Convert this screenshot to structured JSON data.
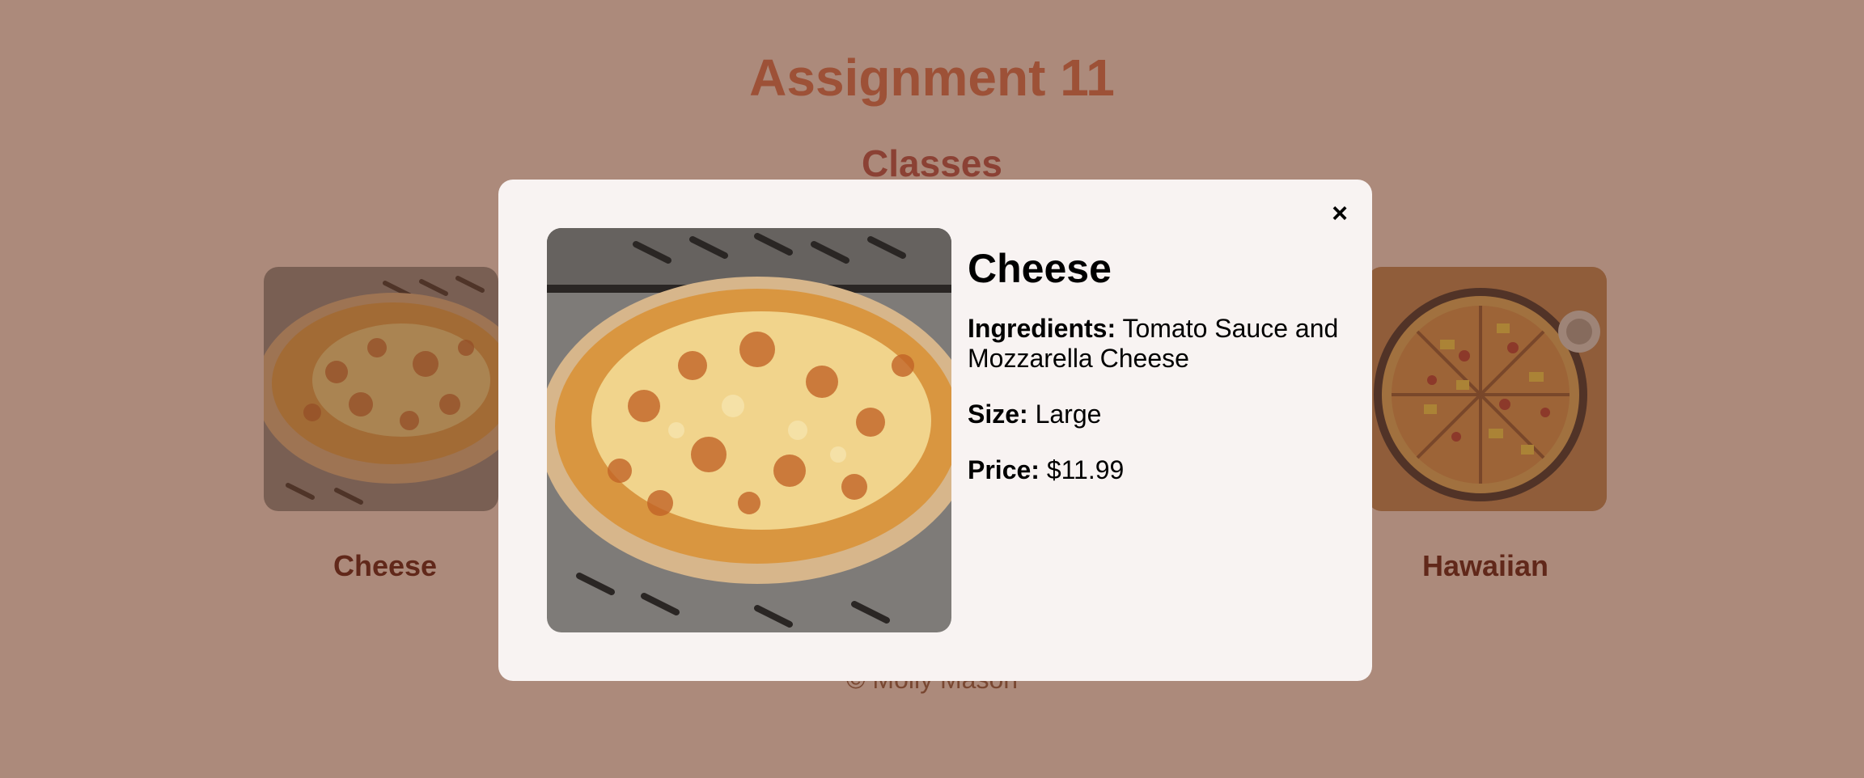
{
  "page": {
    "title": "Assignment 11",
    "subtitle": "Classes",
    "footer": "© Molly Mason"
  },
  "cards": [
    {
      "name": "Cheese",
      "image": "cheese-pizza"
    },
    {
      "name": "Hawaiian",
      "image": "hawaiian-pizza"
    }
  ],
  "modal": {
    "close_label": "×",
    "title": "Cheese",
    "ingredients_label": "Ingredients:",
    "ingredients": "Tomato Sauce and Mozzarella Cheese",
    "size_label": "Size:",
    "size": "Large",
    "price_label": "Price:",
    "price": "$11.99"
  },
  "colors": {
    "background": "#F4E1D6",
    "title": "#D66E4F",
    "subtitle": "#B24E49",
    "card_name": "#5E1C14",
    "overlay": "rgba(100,52,32,0.5)",
    "modal": "#F8F3F2"
  }
}
